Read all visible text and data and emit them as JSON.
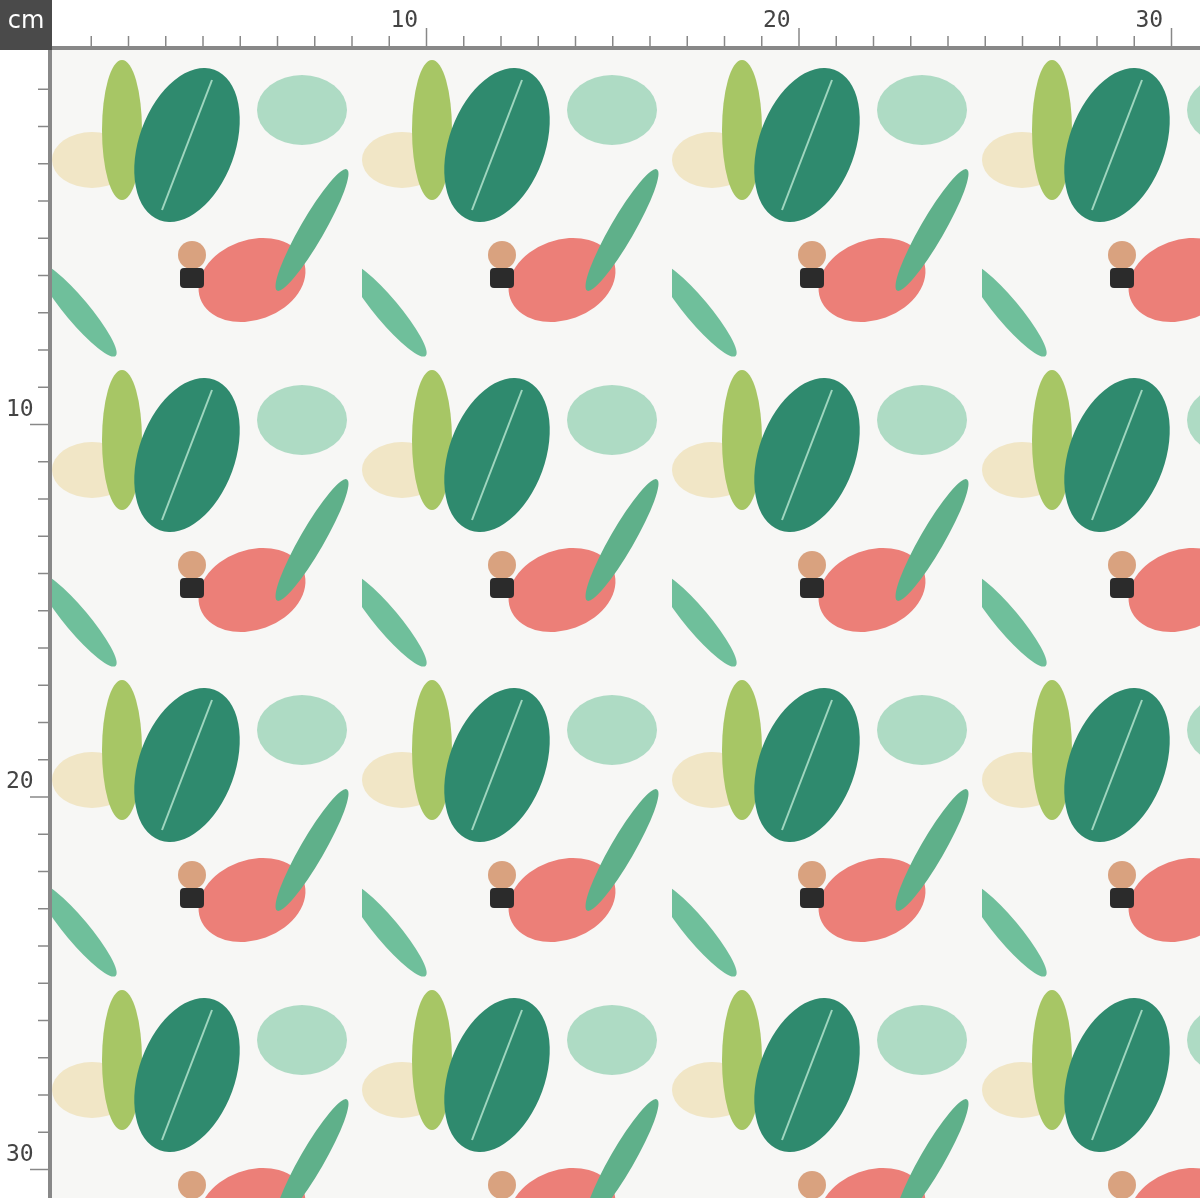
{
  "corner_unit": "cm",
  "top_ruler": {
    "labels": [
      "10",
      "20",
      "30"
    ]
  },
  "left_ruler": {
    "labels": [
      "10",
      "20",
      "30"
    ]
  }
}
